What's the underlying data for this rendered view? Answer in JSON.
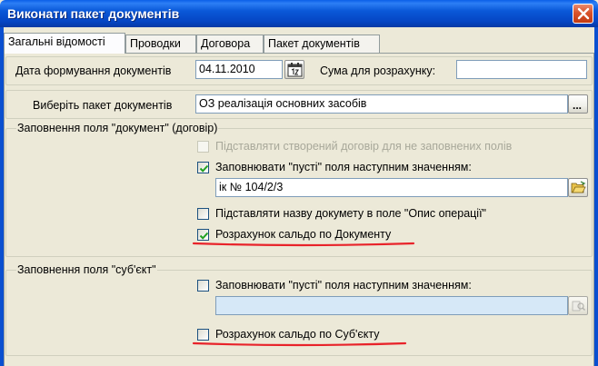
{
  "window": {
    "title": "Виконати пакет документів"
  },
  "tabs": [
    {
      "label": "Загальні відомості",
      "active": true
    },
    {
      "label": "Проводки",
      "active": false
    },
    {
      "label": "Договора",
      "active": false
    },
    {
      "label": "Пакет документів",
      "active": false
    }
  ],
  "general": {
    "date_label": "Дата формування документів",
    "date_value": "04.11.2010",
    "sum_label": "Сума для розрахунку:",
    "sum_value": "",
    "package_label": "Виберіть пакет документів",
    "package_value": "ОЗ реалізація основних засобів",
    "browse_label": "..."
  },
  "document_group": {
    "title": "Заповнення поля \"документ\" (договір)",
    "substitute_contract": {
      "label": "Підставляти створений договір для не заповнених полів",
      "checked": false,
      "enabled": false
    },
    "fill_empty": {
      "label": "Заповнювати \"пусті\" поля наступним значенням:",
      "checked": true,
      "enabled": true
    },
    "fill_value": "ік № 104/2/3",
    "substitute_name": {
      "label": "Підставляти назву докумету в поле \"Опис операції\"",
      "checked": false,
      "enabled": true
    },
    "calc_balance": {
      "label": "Розрахунок сальдо по Документу",
      "checked": true,
      "enabled": true
    }
  },
  "subject_group": {
    "title": "Заповнення поля \"суб'єкт\"",
    "fill_empty": {
      "label": "Заповнювати \"пусті\" поля наступним значенням:",
      "checked": false,
      "enabled": true
    },
    "fill_value": "",
    "calc_balance": {
      "label": "Розрахунок сальдо по Суб'єкту",
      "checked": false,
      "enabled": true
    }
  },
  "colors": {
    "titlebar": "#0A58D8",
    "dialog_bg": "#ECE9D8",
    "annotation_underline": "#E8232A",
    "disabled_field": "#D6E8F7"
  }
}
